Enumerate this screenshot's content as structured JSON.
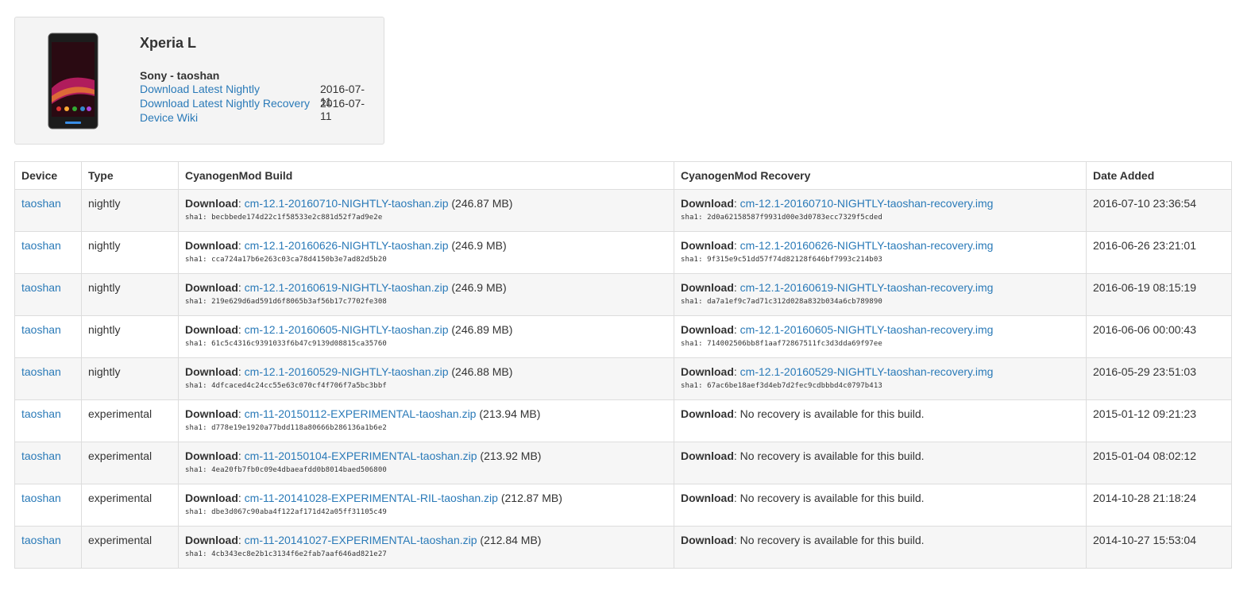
{
  "device_card": {
    "title": "Xperia L",
    "subtitle": "Sony - taoshan",
    "links": [
      {
        "label": "Download Latest Nightly",
        "date": "2016-07-11"
      },
      {
        "label": "Download Latest Nightly Recovery",
        "date": "2016-07-11"
      },
      {
        "label": "Device Wiki",
        "date": ""
      }
    ]
  },
  "table": {
    "headers": [
      "Device",
      "Type",
      "CyanogenMod Build",
      "CyanogenMod Recovery",
      "Date Added"
    ],
    "download_label": "Download",
    "sha_label": "sha1:",
    "rows": [
      {
        "device": "taoshan",
        "type": "nightly",
        "build_file": "cm-12.1-20160710-NIGHTLY-taoshan.zip",
        "build_size": "(246.87 MB)",
        "build_sha": "becbbede174d22c1f58533e2c881d52f7ad9e2e",
        "recovery_file": "cm-12.1-20160710-NIGHTLY-taoshan-recovery.img",
        "recovery_sha": "2d0a62158587f9931d00e3d0783ecc7329f5cded",
        "recovery_text": "",
        "date": "2016-07-10 23:36:54"
      },
      {
        "device": "taoshan",
        "type": "nightly",
        "build_file": "cm-12.1-20160626-NIGHTLY-taoshan.zip",
        "build_size": "(246.9 MB)",
        "build_sha": "cca724a17b6e263c03ca78d4150b3e7ad82d5b20",
        "recovery_file": "cm-12.1-20160626-NIGHTLY-taoshan-recovery.img",
        "recovery_sha": "9f315e9c51dd57f74d82128f646bf7993c214b03",
        "recovery_text": "",
        "date": "2016-06-26 23:21:01"
      },
      {
        "device": "taoshan",
        "type": "nightly",
        "build_file": "cm-12.1-20160619-NIGHTLY-taoshan.zip",
        "build_size": "(246.9 MB)",
        "build_sha": "219e629d6ad591d6f8065b3af56b17c7702fe308",
        "recovery_file": "cm-12.1-20160619-NIGHTLY-taoshan-recovery.img",
        "recovery_sha": "da7a1ef9c7ad71c312d028a832b034a6cb789890",
        "recovery_text": "",
        "date": "2016-06-19 08:15:19"
      },
      {
        "device": "taoshan",
        "type": "nightly",
        "build_file": "cm-12.1-20160605-NIGHTLY-taoshan.zip",
        "build_size": "(246.89 MB)",
        "build_sha": "61c5c4316c9391033f6b47c9139d08815ca35760",
        "recovery_file": "cm-12.1-20160605-NIGHTLY-taoshan-recovery.img",
        "recovery_sha": "714002506bb8f1aaf72867511fc3d3dda69f97ee",
        "recovery_text": "",
        "date": "2016-06-06 00:00:43"
      },
      {
        "device": "taoshan",
        "type": "nightly",
        "build_file": "cm-12.1-20160529-NIGHTLY-taoshan.zip",
        "build_size": "(246.88 MB)",
        "build_sha": "4dfcaced4c24cc55e63c070cf4f706f7a5bc3bbf",
        "recovery_file": "cm-12.1-20160529-NIGHTLY-taoshan-recovery.img",
        "recovery_sha": "67ac6be18aef3d4eb7d2fec9cdbbbd4c0797b413",
        "recovery_text": "",
        "date": "2016-05-29 23:51:03"
      },
      {
        "device": "taoshan",
        "type": "experimental",
        "build_file": "cm-11-20150112-EXPERIMENTAL-taoshan.zip",
        "build_size": "(213.94 MB)",
        "build_sha": "d778e19e1920a77bdd118a80666b286136a1b6e2",
        "recovery_file": "",
        "recovery_sha": "",
        "recovery_text": "No recovery is available for this build.",
        "date": "2015-01-12 09:21:23"
      },
      {
        "device": "taoshan",
        "type": "experimental",
        "build_file": "cm-11-20150104-EXPERIMENTAL-taoshan.zip",
        "build_size": "(213.92 MB)",
        "build_sha": "4ea20fb7fb0c09e4dbaeafdd0b8014baed506800",
        "recovery_file": "",
        "recovery_sha": "",
        "recovery_text": "No recovery is available for this build.",
        "date": "2015-01-04 08:02:12"
      },
      {
        "device": "taoshan",
        "type": "experimental",
        "build_file": "cm-11-20141028-EXPERIMENTAL-RIL-taoshan.zip",
        "build_size": "(212.87 MB)",
        "build_sha": "dbe3d067c90aba4f122af171d42a05ff31105c49",
        "recovery_file": "",
        "recovery_sha": "",
        "recovery_text": "No recovery is available for this build.",
        "date": "2014-10-28 21:18:24"
      },
      {
        "device": "taoshan",
        "type": "experimental",
        "build_file": "cm-11-20141027-EXPERIMENTAL-taoshan.zip",
        "build_size": "(212.84 MB)",
        "build_sha": "4cb343ec8e2b1c3134f6e2fab7aaf646ad821e27",
        "recovery_file": "",
        "recovery_sha": "",
        "recovery_text": "No recovery is available for this build.",
        "date": "2014-10-27 15:53:04"
      }
    ]
  }
}
